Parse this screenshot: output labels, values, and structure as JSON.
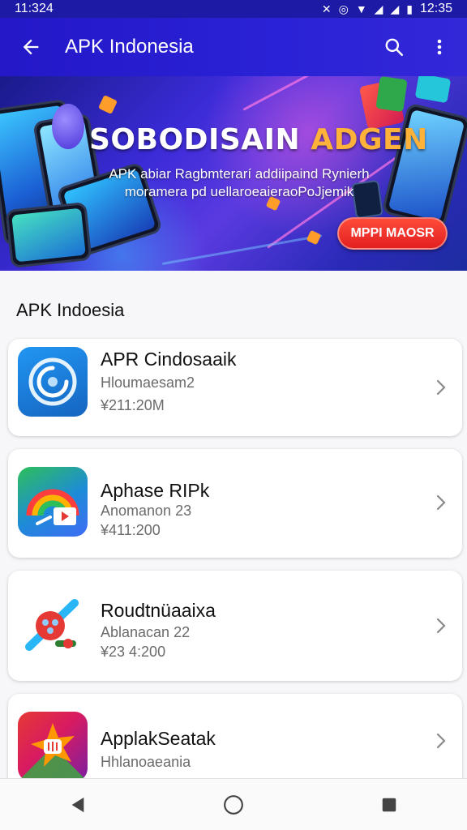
{
  "status_bar": {
    "time_left": "11:324",
    "time_right": "12:35"
  },
  "app_bar": {
    "title": "APK Indonesia"
  },
  "banner": {
    "headline_part1": "SOBODISAIN",
    "headline_part2": "ADGEN",
    "subtitle_line1": "AРK abiar Ragbmterarí addiipaind Rynierh",
    "subtitle_line2": "moramera pd uellaroeaieraoPoJjemik",
    "cta_label": "MPPI MAOSR"
  },
  "section": {
    "title": "APK Indoesia"
  },
  "apps": [
    {
      "name": "APR Cindosaaik",
      "developer": "Hloumaesam2",
      "size": "¥211:20M",
      "icon": "swirl-app-icon",
      "colors": [
        "#1e88e5",
        "#0d47a1"
      ]
    },
    {
      "name": "Aphase RIPk",
      "developer": "Anomanon 23",
      "size": "¥411:200",
      "icon": "rainbow-video-app-icon",
      "colors": [
        "#3f6cf5",
        "#28a745"
      ]
    },
    {
      "name": "Roudtnüaaixa",
      "developer": "Ablanacan 22",
      "size": "¥23 4:200",
      "icon": "rocket-app-icon",
      "colors": [
        "#e53935",
        "#29b6f6"
      ]
    },
    {
      "name": "ApplakSeatak",
      "developer": "Hhlanoaeania",
      "size": "",
      "icon": "star-burst-app-icon",
      "colors": [
        "#e53935",
        "#ff9800"
      ]
    }
  ],
  "nav": {
    "back": "back-icon",
    "home": "home-icon",
    "recents": "recents-icon"
  }
}
